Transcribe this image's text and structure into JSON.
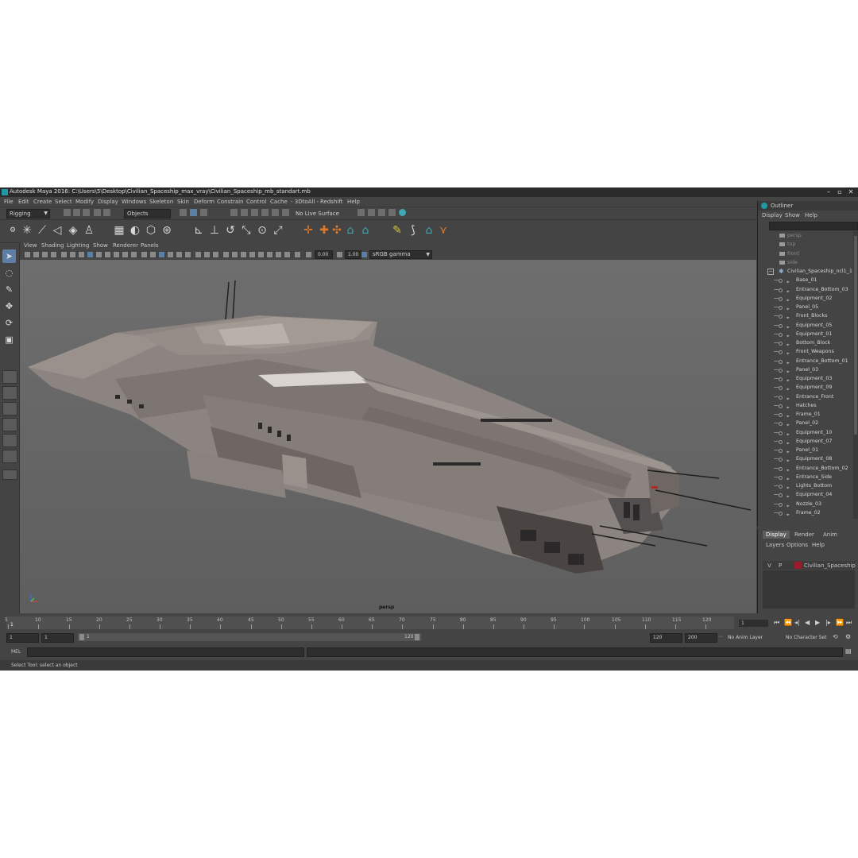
{
  "window": {
    "title": "Autodesk Maya 2016: C:\\Users\\5\\Desktop\\Civilian_Spaceship_max_vray\\Civilian_Spaceship_mb_standart.mb",
    "minimize": "–",
    "maximize": "▫",
    "close": "✕"
  },
  "menus": [
    "File",
    "Edit",
    "Create",
    "Select",
    "Modify",
    "Display",
    "Windows",
    "Skeleton",
    "Skin",
    "Deform",
    "Constrain",
    "Control",
    "Cache",
    "- 3DtoAll -",
    "Redshift",
    "Help"
  ],
  "status_line": {
    "menuset": "Rigging",
    "selection_mode": "Objects",
    "live_surface": "No Live Surface"
  },
  "panel_menu": [
    "View",
    "Shading",
    "Lighting",
    "Show",
    "Renderer",
    "Panels"
  ],
  "panel_toolbar": {
    "exposure": "0.00",
    "gamma": "1.00",
    "color_space": "sRGB gamma"
  },
  "viewport": {
    "camera_label": "persp"
  },
  "outliner": {
    "title": "Outliner",
    "menu": [
      "Display",
      "Show",
      "Help"
    ],
    "cameras": [
      "persp",
      "top",
      "front",
      "side"
    ],
    "root": "Civilian_Spaceship_ncl1_1",
    "children": [
      "Base_01",
      "Entrance_Bottom_03",
      "Equipment_02",
      "Panel_05",
      "Front_Blocks",
      "Equipment_05",
      "Equipment_01",
      "Bottom_Block",
      "Front_Weapons",
      "Entrance_Bottom_01",
      "Panel_03",
      "Equipment_03",
      "Equipment_09",
      "Entrance_Front",
      "Hatches",
      "Frame_01",
      "Panel_02",
      "Equipment_10",
      "Equipment_07",
      "Panel_01",
      "Equipment_08",
      "Entrance_Bottom_02",
      "Entrance_Side",
      "Lights_Bottom",
      "Equipment_04",
      "Nozzle_03",
      "Frame_02"
    ]
  },
  "layer_editor": {
    "tabs": [
      "Display",
      "Render",
      "Anim"
    ],
    "menu": [
      "Layers",
      "Options",
      "Help"
    ],
    "layer": {
      "visible": "V",
      "playback": "P",
      "name": "Civilian_Spaceship",
      "color": "#9b1b2c"
    }
  },
  "timeline": {
    "ticks": [
      "5",
      "10",
      "15",
      "20",
      "25",
      "30",
      "35",
      "40",
      "45",
      "50",
      "55",
      "60",
      "65",
      "70",
      "75",
      "80",
      "85",
      "90",
      "95",
      "100",
      "105",
      "110",
      "115",
      "120"
    ],
    "start_marker": "1",
    "current_frame": "1"
  },
  "range": {
    "start": "1",
    "anim_start": "1",
    "slider_start": "1",
    "slider_end": "120",
    "end": "120",
    "anim_end": "200",
    "anim_layer": "No Anim Layer",
    "character_set": "No Character Set"
  },
  "command_line": {
    "label": "MEL"
  },
  "help_line": "Select Tool: select an object"
}
